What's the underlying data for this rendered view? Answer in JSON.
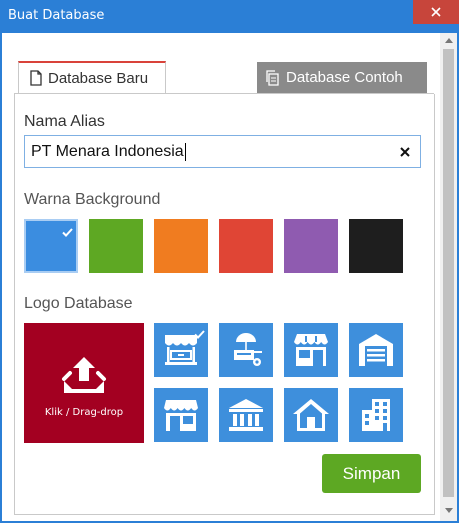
{
  "window": {
    "title": "Buat Database"
  },
  "tabs": [
    {
      "label": "Database Baru",
      "active": true
    },
    {
      "label": "Database Contoh",
      "active": false
    }
  ],
  "alias": {
    "label": "Nama Alias",
    "value": "PT Menara Indonesia"
  },
  "background": {
    "label": "Warna Background",
    "colors": [
      "#3b8de0",
      "#5ea823",
      "#f07c20",
      "#e04535",
      "#8f5bb0",
      "#1e1e1e"
    ],
    "selected_index": 0
  },
  "logo": {
    "label": "Logo Database",
    "upload_label": "Klik / Drag-drop",
    "icons": [
      "market-stall-icon",
      "food-cart-icon",
      "shop-icon",
      "garage-icon",
      "kiosk-icon",
      "bank-icon",
      "house-icon",
      "office-building-icon"
    ],
    "selected_index": 0
  },
  "actions": {
    "save_label": "Simpan"
  },
  "theme": {
    "titlebar": "#2b7fd6",
    "close": "#c7453b",
    "accent_tab": "#d9433a",
    "tile": "#3e8fdc",
    "upload": "#a30021",
    "save": "#5da823"
  }
}
